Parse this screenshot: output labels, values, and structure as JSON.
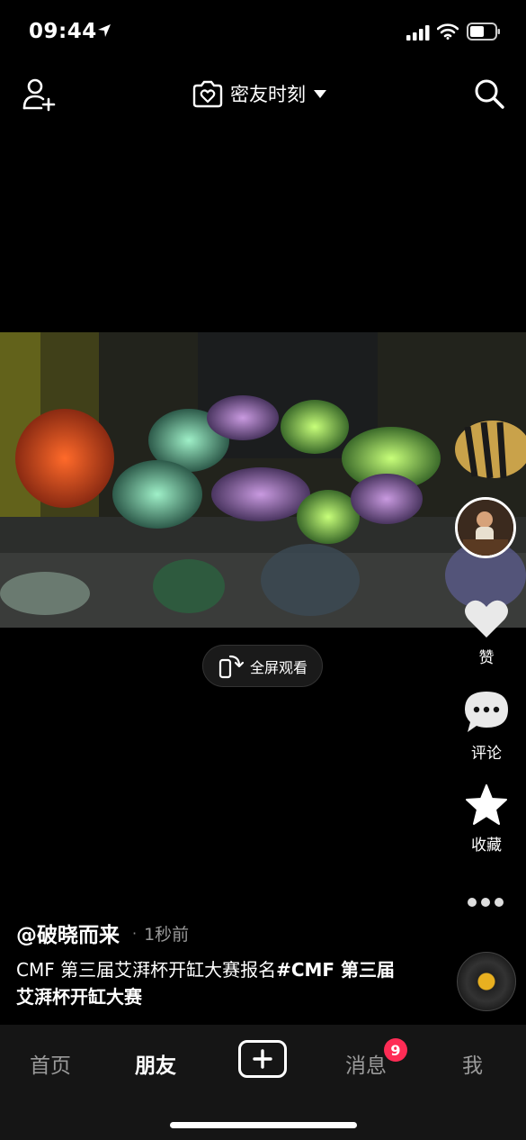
{
  "status_bar": {
    "time": "09:44",
    "icons": [
      "location-arrow-icon",
      "cellular-signal-icon",
      "wifi-icon",
      "battery-icon"
    ]
  },
  "top_nav": {
    "left_icon": "add-friend-icon",
    "channel_label": "密友时刻",
    "channel_icon": "heart-camera-icon",
    "right_icon": "search-icon"
  },
  "video": {
    "fullscreen_label": "全屏观看"
  },
  "actions": {
    "like": "赞",
    "comment": "评论",
    "favorite": "收藏",
    "more_icon": "more-dots-icon"
  },
  "post": {
    "author": "@破晓而来",
    "separator": "·",
    "time": "1秒前",
    "caption_text": "CMF 第三届艾湃杯开缸大赛报名",
    "caption_tag": "#CMF 第三届艾湃杯开缸大赛"
  },
  "tab_bar": {
    "tabs": [
      {
        "label": "首页",
        "active": false
      },
      {
        "label": "朋友",
        "active": true
      },
      {
        "label": "消息",
        "active": false,
        "badge": "9"
      },
      {
        "label": "我",
        "active": false
      }
    ],
    "create_icon": "plus-icon"
  },
  "colors": {
    "background": "#000000",
    "tab_bar": "#151515",
    "badge": "#fe2c55",
    "inactive_text": "#9a9a9a"
  }
}
